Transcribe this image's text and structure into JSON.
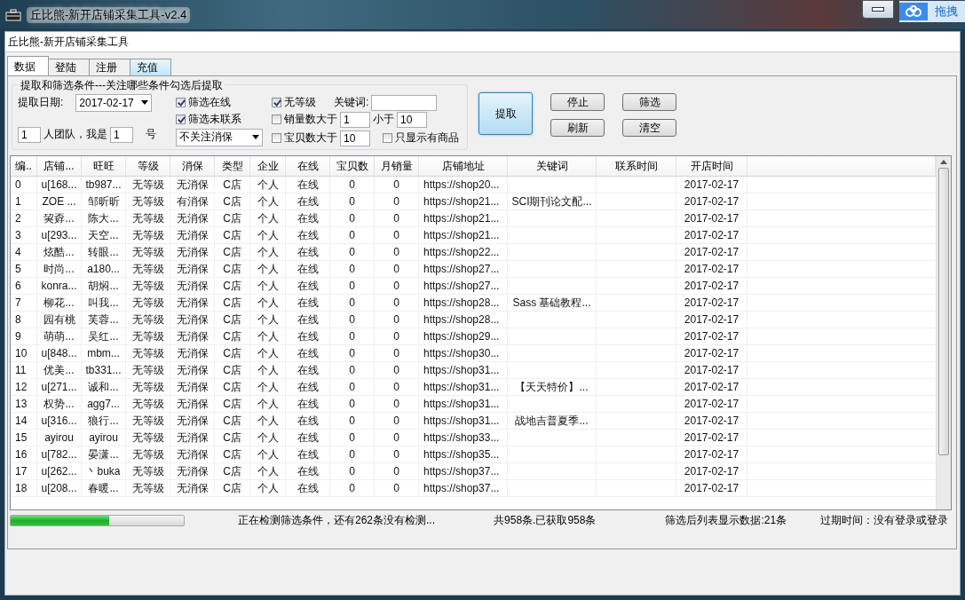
{
  "window": {
    "title": "丘比熊-新开店铺采集工具-v2.4"
  },
  "cloud_widget": {
    "label": "拖拽"
  },
  "app": {
    "caption": "丘比熊-新开店铺采集工具"
  },
  "tabs": [
    {
      "label": "数据",
      "selected": true,
      "hovered": false
    },
    {
      "label": "登陆",
      "selected": false,
      "hovered": false
    },
    {
      "label": "注册",
      "selected": false,
      "hovered": false
    },
    {
      "label": "充值",
      "selected": false,
      "hovered": true
    }
  ],
  "filters": {
    "legend": "提取和筛选条件---关注哪些条件勾选后提取",
    "date_label": "提取日期:",
    "date": "2017-02-17",
    "team_size": "1",
    "team_label": "人团队，我是",
    "member_no": "1",
    "member_suffix": "号",
    "guarantee_select": "不关注消保",
    "keyword_label": "关键词:",
    "sales_min": "1",
    "less_than_label": "小于",
    "sales_max": "10",
    "items_min": "10",
    "checks": [
      {
        "label": "筛选在线",
        "checked": true
      },
      {
        "label": "筛选未联系",
        "checked": true
      },
      {
        "label": "无等级",
        "checked": true
      },
      {
        "label": "销量数大于",
        "checked": false
      },
      {
        "label": "宝贝数大于",
        "checked": false
      },
      {
        "label": "只显示有商品",
        "checked": false
      }
    ]
  },
  "buttons": [
    {
      "label": "提取",
      "kind": "primary"
    },
    {
      "label": "停止",
      "kind": "small"
    },
    {
      "label": "筛选",
      "kind": "small"
    },
    {
      "label": "刷新",
      "kind": "small"
    },
    {
      "label": "清空",
      "kind": "small"
    }
  ],
  "table": {
    "columns": [
      "编..",
      "店铺...",
      "旺旺",
      "等级",
      "消保",
      "类型",
      "企业",
      "在线",
      "宝贝数",
      "月销量",
      "店铺地址",
      "关键词",
      "联系时间",
      "开店时间"
    ],
    "rows": [
      {
        "no": "0",
        "shop": "u[168...",
        "wangwang": "tb987...",
        "level": "无等级",
        "guarantee": "无消保",
        "type": "C店",
        "company": "个人",
        "online": "在线",
        "items": "0",
        "sales": "0",
        "url": "https://shop20...",
        "opened": "2017-02-17"
      },
      {
        "no": "1",
        "shop": "ZOE ...",
        "wangwang": "邹昕昕",
        "level": "无等级",
        "guarantee": "有消保",
        "type": "C店",
        "company": "个人",
        "online": "在线",
        "items": "0",
        "sales": "0",
        "url": "https://shop21...",
        "keyword": "SCI期刊论文配...",
        "opened": "2017-02-17"
      },
      {
        "no": "2",
        "shop": "巭孬...",
        "wangwang": "陈大...",
        "level": "无等级",
        "guarantee": "无消保",
        "type": "C店",
        "company": "个人",
        "online": "在线",
        "items": "0",
        "sales": "0",
        "url": "https://shop21...",
        "opened": "2017-02-17"
      },
      {
        "no": "3",
        "shop": "u[293...",
        "wangwang": "天空...",
        "level": "无等级",
        "guarantee": "无消保",
        "type": "C店",
        "company": "个人",
        "online": "在线",
        "items": "0",
        "sales": "0",
        "url": "https://shop21...",
        "opened": "2017-02-17"
      },
      {
        "no": "4",
        "shop": "炫酷...",
        "wangwang": "转眼...",
        "level": "无等级",
        "guarantee": "无消保",
        "type": "C店",
        "company": "个人",
        "online": "在线",
        "items": "0",
        "sales": "0",
        "url": "https://shop22...",
        "opened": "2017-02-17"
      },
      {
        "no": "5",
        "shop": "时尚...",
        "wangwang": "a180...",
        "level": "无等级",
        "guarantee": "无消保",
        "type": "C店",
        "company": "个人",
        "online": "在线",
        "items": "0",
        "sales": "0",
        "url": "https://shop27...",
        "opened": "2017-02-17"
      },
      {
        "no": "6",
        "shop": "konra...",
        "wangwang": "胡焖...",
        "level": "无等级",
        "guarantee": "无消保",
        "type": "C店",
        "company": "个人",
        "online": "在线",
        "items": "0",
        "sales": "0",
        "url": "https://shop27...",
        "opened": "2017-02-17"
      },
      {
        "no": "7",
        "shop": "柳花...",
        "wangwang": "叫我...",
        "level": "无等级",
        "guarantee": "无消保",
        "type": "C店",
        "company": "个人",
        "online": "在线",
        "items": "0",
        "sales": "0",
        "url": "https://shop28...",
        "keyword": "Sass 基础教程...",
        "opened": "2017-02-17"
      },
      {
        "no": "8",
        "shop": "园有桃",
        "wangwang": "芙蓉...",
        "level": "无等级",
        "guarantee": "无消保",
        "type": "C店",
        "company": "个人",
        "online": "在线",
        "items": "0",
        "sales": "0",
        "url": "https://shop28...",
        "opened": "2017-02-17"
      },
      {
        "no": "9",
        "shop": "萌萌...",
        "wangwang": "吴红...",
        "level": "无等级",
        "guarantee": "无消保",
        "type": "C店",
        "company": "个人",
        "online": "在线",
        "items": "0",
        "sales": "0",
        "url": "https://shop29...",
        "opened": "2017-02-17"
      },
      {
        "no": "10",
        "shop": "u[848...",
        "wangwang": "mbm...",
        "level": "无等级",
        "guarantee": "无消保",
        "type": "C店",
        "company": "个人",
        "online": "在线",
        "items": "0",
        "sales": "0",
        "url": "https://shop30...",
        "opened": "2017-02-17"
      },
      {
        "no": "11",
        "shop": "优美...",
        "wangwang": "tb331...",
        "level": "无等级",
        "guarantee": "无消保",
        "type": "C店",
        "company": "个人",
        "online": "在线",
        "items": "0",
        "sales": "0",
        "url": "https://shop31...",
        "opened": "2017-02-17"
      },
      {
        "no": "12",
        "shop": "u[271...",
        "wangwang": "诚和...",
        "level": "无等级",
        "guarantee": "无消保",
        "type": "C店",
        "company": "个人",
        "online": "在线",
        "items": "0",
        "sales": "0",
        "url": "https://shop31...",
        "keyword": "【天天特价】...",
        "opened": "2017-02-17"
      },
      {
        "no": "13",
        "shop": "权势...",
        "wangwang": "agg7...",
        "level": "无等级",
        "guarantee": "无消保",
        "type": "C店",
        "company": "个人",
        "online": "在线",
        "items": "0",
        "sales": "0",
        "url": "https://shop31...",
        "opened": "2017-02-17"
      },
      {
        "no": "14",
        "shop": "u[316...",
        "wangwang": "狼行...",
        "level": "无等级",
        "guarantee": "无消保",
        "type": "C店",
        "company": "个人",
        "online": "在线",
        "items": "0",
        "sales": "0",
        "url": "https://shop31...",
        "keyword": "战地吉普夏季...",
        "opened": "2017-02-17"
      },
      {
        "no": "15",
        "shop": "ayirou",
        "wangwang": "ayirou",
        "level": "无等级",
        "guarantee": "无消保",
        "type": "C店",
        "company": "个人",
        "online": "在线",
        "items": "0",
        "sales": "0",
        "url": "https://shop33...",
        "opened": "2017-02-17"
      },
      {
        "no": "16",
        "shop": "u[782...",
        "wangwang": "晏潇...",
        "level": "无等级",
        "guarantee": "无消保",
        "type": "C店",
        "company": "个人",
        "online": "在线",
        "items": "0",
        "sales": "0",
        "url": "https://shop35...",
        "opened": "2017-02-17"
      },
      {
        "no": "17",
        "shop": "u[262...",
        "wangwang": "丶buka",
        "level": "无等级",
        "guarantee": "无消保",
        "type": "C店",
        "company": "个人",
        "online": "在线",
        "items": "0",
        "sales": "0",
        "url": "https://shop37...",
        "opened": "2017-02-17"
      },
      {
        "no": "18",
        "shop": "u[208...",
        "wangwang": "春暖...",
        "level": "无等级",
        "guarantee": "无消保",
        "type": "C店",
        "company": "个人",
        "online": "在线",
        "items": "0",
        "sales": "0",
        "url": "https://shop37...",
        "opened": "2017-02-17"
      }
    ]
  },
  "status": {
    "progress": {
      "level": 0.57
    },
    "message": "正在检测筛选条件，还有262条没有检测...",
    "total": "共958条.已获取958条",
    "filtered": "筛选后列表显示数据:21条",
    "expiry": "过期时间：没有登录或登录"
  }
}
